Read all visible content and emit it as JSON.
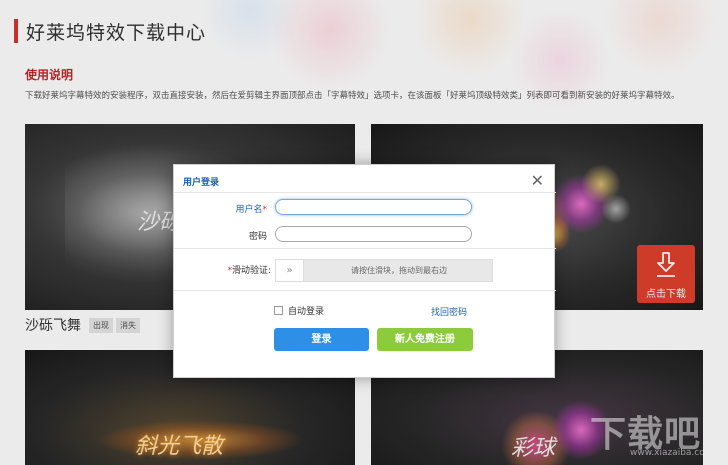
{
  "header": {
    "title": "好莱坞特效下载中心"
  },
  "usage": {
    "title": "使用说明",
    "text": "下载好莱坞字幕特效的安装程序，双击直接安装，然后在爱剪辑主界面顶部点击「字幕特效」选项卡，在该面板「好莱坞顶级特效类」列表即可看到新安装的好莱坞字幕特效。"
  },
  "thumbs": {
    "t1_word": "沙砾",
    "t3_word": "斜光飞散",
    "t4_word": "彩球"
  },
  "download": {
    "label": "点击下载",
    "icon": "download-arrow-icon",
    "color": "#e0402d"
  },
  "caption": {
    "title": "沙砾飞舞",
    "tags": [
      "出现",
      "消失"
    ]
  },
  "watermark": {
    "text": "下载吧",
    "url": "www.xiazaiba.com"
  },
  "modal": {
    "title": "用户登录",
    "close_icon": "close-icon",
    "username_label": "用户名",
    "username_value": "",
    "password_label": "密码",
    "password_value": "",
    "verify_label": "滑动验证:",
    "slider_handle": "»",
    "slider_text": "请按住滑块，拖动到最右边",
    "remember_label": "自动登录",
    "forgot_link": "找回密码",
    "login_button": "登录",
    "register_button": "新人免费注册"
  },
  "colors": {
    "accent_red": "#d8322e",
    "link_blue": "#1f5fb0",
    "login_blue": "#2d8fe6",
    "register_green": "#8ccb3b"
  }
}
